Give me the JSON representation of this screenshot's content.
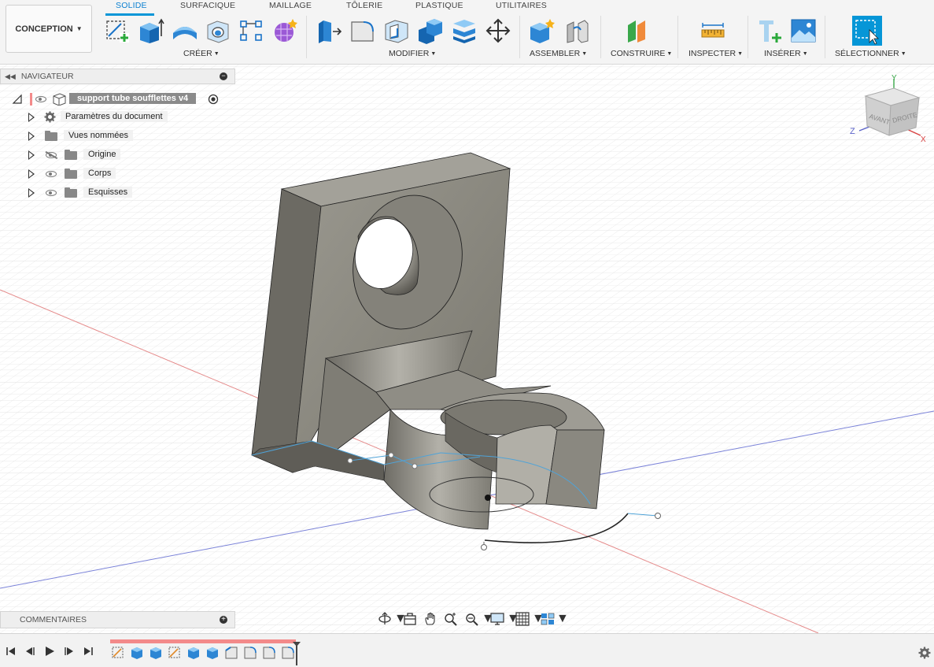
{
  "workspace": {
    "label": "CONCEPTION"
  },
  "tabs": [
    {
      "label": "SOLIDE",
      "active": true
    },
    {
      "label": "SURFACIQUE"
    },
    {
      "label": "MAILLAGE"
    },
    {
      "label": "TÔLERIE"
    },
    {
      "label": "PLASTIQUE"
    },
    {
      "label": "UTILITAIRES"
    }
  ],
  "groups": {
    "create": "CRÉER",
    "modify": "MODIFIER",
    "assemble": "ASSEMBLER",
    "construct": "CONSTRUIRE",
    "inspect": "INSPECTER",
    "insert": "INSÉRER",
    "select": "SÉLECTIONNER"
  },
  "navigator": {
    "title": "NAVIGATEUR",
    "root": "support tube soufflettes v4",
    "items": [
      {
        "label": "Paramètres du document",
        "icon": "gear-icon"
      },
      {
        "label": "Vues nommées",
        "icon": "folder-icon"
      },
      {
        "label": "Origine",
        "icon": "folder-icon",
        "visible": false
      },
      {
        "label": "Corps",
        "icon": "folder-icon",
        "visible": true
      },
      {
        "label": "Esquisses",
        "icon": "folder-icon",
        "visible": true
      }
    ]
  },
  "comments": {
    "title": "COMMENTAIRES"
  },
  "viewcube": {
    "front": "AVANT",
    "right": "DROITE",
    "axis_x": "X",
    "axis_y": "Y",
    "axis_z": "Z"
  },
  "colors": {
    "accent": "#0696d7",
    "timeline": "#f38a8a",
    "body": "#8c8a82"
  }
}
